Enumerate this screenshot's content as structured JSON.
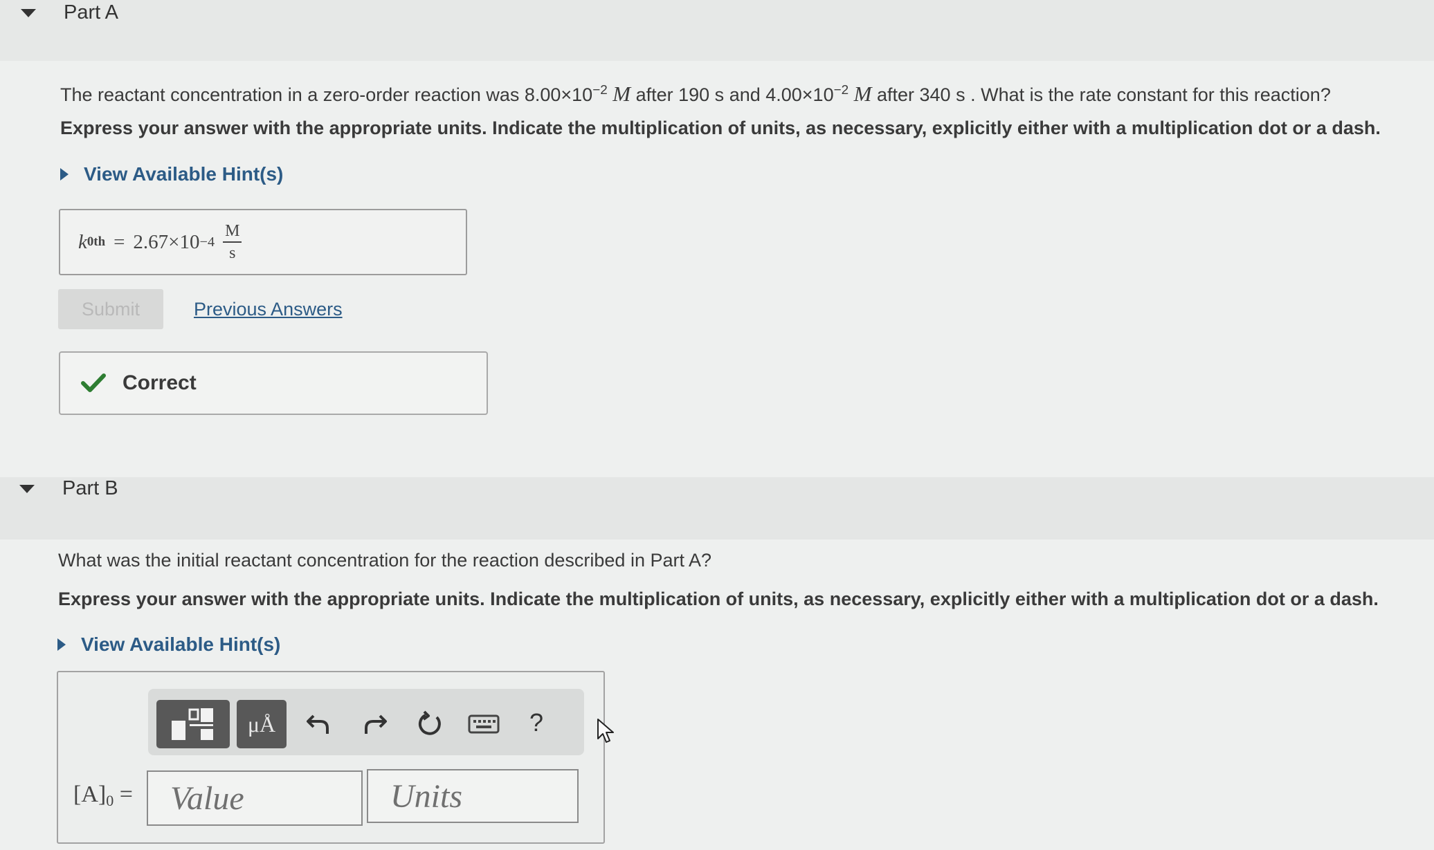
{
  "part_a": {
    "title": "Part A",
    "question_prefix": "The reactant concentration in a zero-order reaction was 8.00×10",
    "exp1": "−2",
    "unit_m1": "M",
    "mid1": "after 190 s and 4.00×10",
    "exp2": "−2",
    "unit_m2": "M",
    "question_suffix": "after 340 s . What is the rate constant for this reaction?",
    "instructions": "Express your answer with the appropriate units. Indicate the multiplication of units, as necessary, explicitly either with a multiplication dot or a dash.",
    "hint_label": "View Available Hint(s)",
    "answer": {
      "var": "k",
      "var_sub": "0th",
      "equals": "=",
      "mantissa": "2.67×10",
      "exponent": "−4",
      "unit_num": "M",
      "unit_den": "s"
    },
    "submit_label": "Submit",
    "previous_answers_label": "Previous Answers",
    "feedback": "Correct"
  },
  "part_b": {
    "title": "Part B",
    "question": "What was the initial reactant concentration for the reaction described in Part A?",
    "instructions": "Express your answer with the appropriate units. Indicate the multiplication of units, as necessary, explicitly either with a multiplication dot or a dash.",
    "hint_label": "View Available Hint(s)",
    "toolbar": {
      "units_symbol": "μÅ",
      "help_label": "?"
    },
    "input": {
      "label_main": "[A]",
      "label_sub": "0",
      "label_eq": " =",
      "value_placeholder": "Value",
      "units_placeholder": "Units"
    }
  },
  "colors": {
    "link": "#2c5b86",
    "check": "#2e7d32"
  },
  "icons": [
    "collapse-triangle-icon",
    "expand-triangle-icon",
    "checkmark-icon",
    "template-icon",
    "undo-icon",
    "redo-icon",
    "reset-icon",
    "keyboard-icon",
    "mouse-cursor-icon"
  ]
}
